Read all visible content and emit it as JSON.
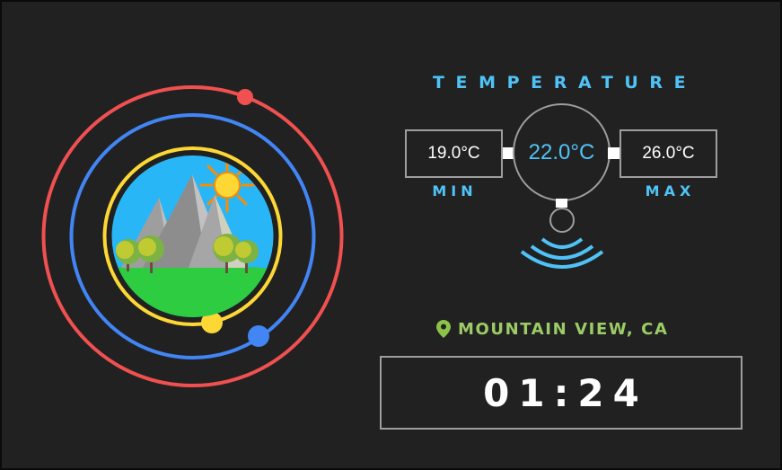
{
  "temperature": {
    "title": "TEMPERATURE",
    "current": "22.0°C",
    "min_value": "19.0°C",
    "max_value": "26.0°C",
    "min_label": "MIN",
    "max_label": "MAX"
  },
  "location": {
    "icon": "location-pin-icon",
    "text": "MOUNTAIN VIEW, CA"
  },
  "clock": {
    "time": "01:24"
  },
  "scene": {
    "illustration": "mountain-landscape",
    "icons": [
      "sun-icon",
      "mountain-icon",
      "tree-icon"
    ]
  },
  "colors": {
    "background": "#212121",
    "accent_blue": "#4fc3f7",
    "location_green": "#9ccc65",
    "orbit_outer": "#f05050",
    "orbit_middle": "#4285f4",
    "orbit_inner": "#fdd835",
    "sky": "#29b6f6"
  }
}
